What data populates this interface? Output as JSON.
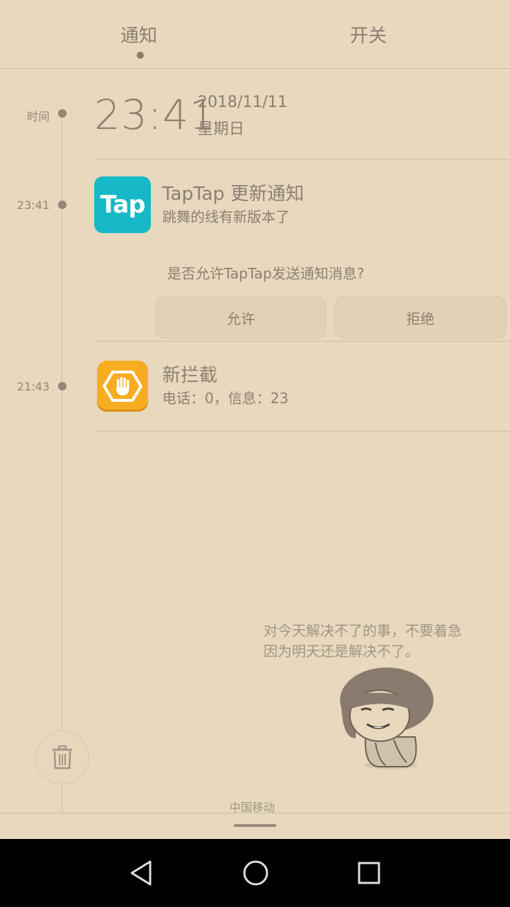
{
  "tabs": [
    {
      "label": "通知",
      "active": true
    },
    {
      "label": "开关",
      "active": false
    }
  ],
  "timeline": {
    "header_label": "时间",
    "big_time": "23:41",
    "date": "2018/11/11",
    "weekday": "星期日"
  },
  "notifications": [
    {
      "time": "23:41",
      "icon": "taptap-app-icon",
      "icon_text": "Tap",
      "title": "TapTap 更新通知",
      "subtitle": "跳舞的线有新版本了",
      "prompt": "是否允许TapTap发送通知消息?",
      "allow_label": "允许",
      "deny_label": "拒绝"
    },
    {
      "time": "21:43",
      "icon": "block-hand-app-icon",
      "title": "新拦截",
      "subtitle": "电话：0，信息：23"
    }
  ],
  "empty_quote": {
    "line1": "对今天解决不了的事，不要着急",
    "line2": "因为明天还是解决不了。"
  },
  "carrier": "中国移动",
  "colors": {
    "background": "#e7d8be",
    "text": "#8f7f72",
    "tap_icon": "#17b8c7",
    "block_icon": "#f7ad21"
  }
}
